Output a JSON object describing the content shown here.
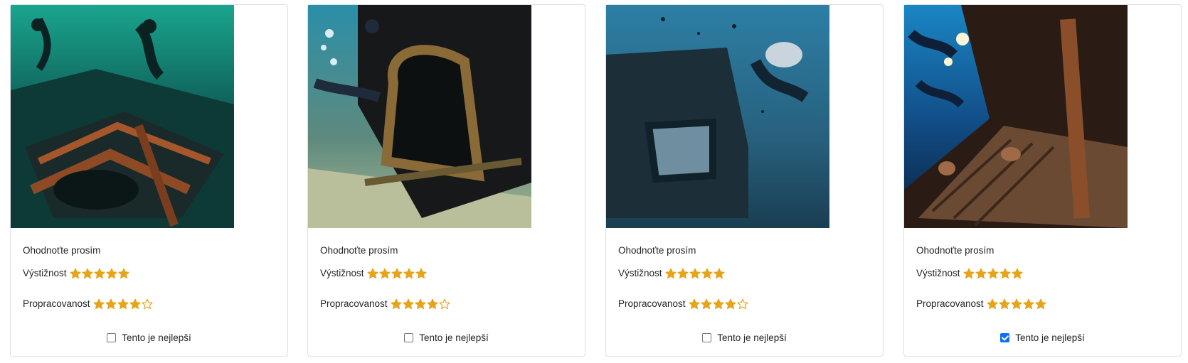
{
  "colors": {
    "star": "#e7a418",
    "checkbox_accent": "#0d6efd"
  },
  "cards": [
    {
      "photo_alt": "wreck-photo",
      "prompt": "Ohodnoťte prosím",
      "ratings": [
        {
          "label": "Výstižnost",
          "value": 5,
          "max": 5
        },
        {
          "label": "Propracovanost",
          "value": 4,
          "max": 5
        }
      ],
      "best_label": "Tento je nejlepší",
      "best_checked": false
    },
    {
      "photo_alt": "wreck-photo",
      "prompt": "Ohodnoťte prosím",
      "ratings": [
        {
          "label": "Výstižnost",
          "value": 5,
          "max": 5
        },
        {
          "label": "Propracovanost",
          "value": 4,
          "max": 5
        }
      ],
      "best_label": "Tento je nejlepší",
      "best_checked": false
    },
    {
      "photo_alt": "wreck-photo",
      "prompt": "Ohodnoťte prosím",
      "ratings": [
        {
          "label": "Výstižnost",
          "value": 5,
          "max": 5
        },
        {
          "label": "Propracovanost",
          "value": 4,
          "max": 5
        }
      ],
      "best_label": "Tento je nejlepší",
      "best_checked": false
    },
    {
      "photo_alt": "wreck-photo",
      "prompt": "Ohodnoťte prosím",
      "ratings": [
        {
          "label": "Výstižnost",
          "value": 5,
          "max": 5
        },
        {
          "label": "Propracovanost",
          "value": 5,
          "max": 5
        }
      ],
      "best_label": "Tento je nejlepší",
      "best_checked": true
    }
  ]
}
